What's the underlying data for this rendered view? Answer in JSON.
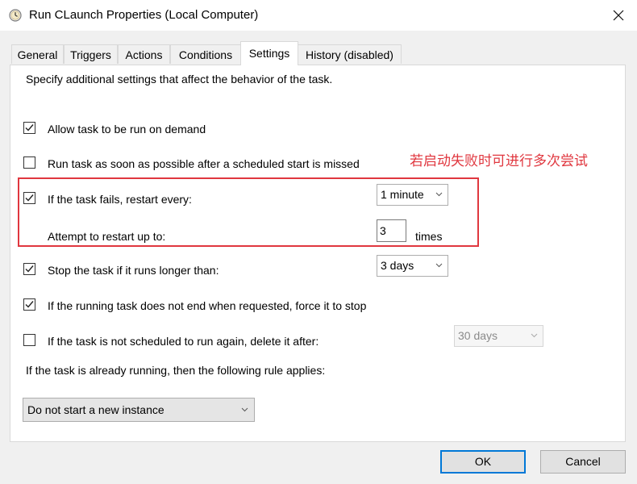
{
  "window": {
    "title": "Run CLaunch Properties (Local Computer)",
    "icon": "clock-icon"
  },
  "tabs": [
    {
      "label": "General",
      "active": false
    },
    {
      "label": "Triggers",
      "active": false
    },
    {
      "label": "Actions",
      "active": false
    },
    {
      "label": "Conditions",
      "active": false
    },
    {
      "label": "Settings",
      "active": true
    },
    {
      "label": "History (disabled)",
      "active": false
    }
  ],
  "settings": {
    "description": "Specify additional settings that affect the behavior of the task.",
    "allow_on_demand": {
      "label": "Allow task to be run on demand",
      "checked": true
    },
    "run_asap": {
      "label": "Run task as soon as possible after a scheduled start is missed",
      "checked": false
    },
    "restart_on_fail": {
      "label": "If the task fails, restart every:",
      "checked": true,
      "interval": "1 minute"
    },
    "restart_attempts": {
      "label": "Attempt to restart up to:",
      "value": "3",
      "unit": "times"
    },
    "stop_if_long": {
      "label": "Stop the task if it runs longer than:",
      "checked": true,
      "duration": "3 days"
    },
    "force_stop": {
      "label": "If the running task does not end when requested, force it to stop",
      "checked": true
    },
    "delete_after": {
      "label": "If the task is not scheduled to run again, delete it after:",
      "checked": false,
      "duration": "30 days"
    },
    "rule_label": "If the task is already running, then the following rule applies:",
    "rule_value": "Do not start a new instance"
  },
  "annotation": {
    "text": "若启动失败时可进行多次尝试",
    "color": "#e0373f"
  },
  "buttons": {
    "ok": "OK",
    "cancel": "Cancel"
  },
  "colors": {
    "accent": "#0078d7",
    "annotation": "#e0373f"
  }
}
